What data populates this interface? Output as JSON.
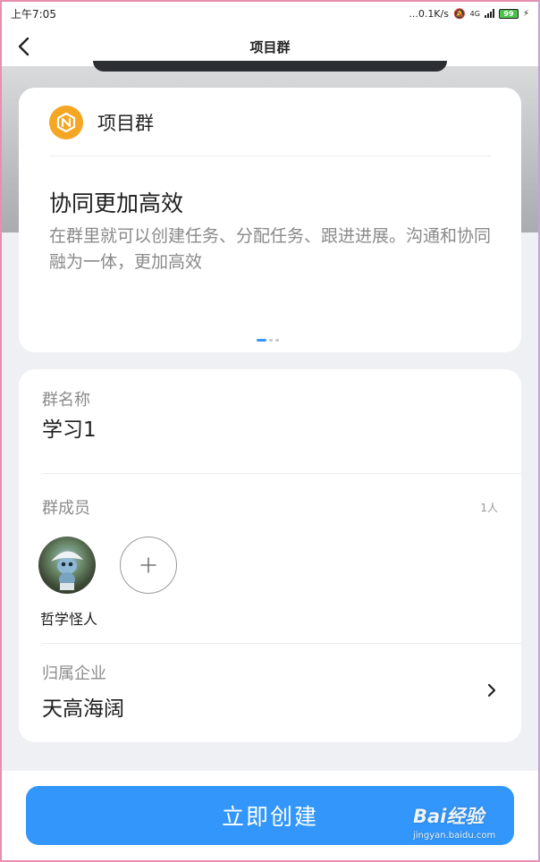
{
  "status_bar": {
    "time": "上午7:05",
    "network_speed": "...0.1K/s",
    "network_type": "4G",
    "battery": "99",
    "icons": [
      "bell-off-icon",
      "signal-icon",
      "battery-icon",
      "charging-icon"
    ]
  },
  "nav": {
    "title": "项目群",
    "back_icon": "chevron-left-icon"
  },
  "intro": {
    "brand_name": "项目群",
    "brand_icon": "project-group-logo-icon",
    "heading": "协同更加高效",
    "description": "在群里就可以创建任务、分配任务、跟进进展。沟通和协同融为一体，更加高效",
    "pager": {
      "pages": 3,
      "active": 1
    }
  },
  "form": {
    "group_name_label": "群名称",
    "group_name_value": "学习1",
    "members_label": "群成员",
    "members_count": "1人",
    "members": [
      {
        "name": "哲学怪人"
      }
    ],
    "add_member_icon": "plus-icon",
    "company_label": "归属企业",
    "company_value": "天高海阔",
    "company_icon": "chevron-right-icon"
  },
  "footer": {
    "create_label": "立即创建"
  },
  "watermark": {
    "logo": "Bai经验",
    "url": "jingyan.baidu.com"
  },
  "colors": {
    "accent": "#3296fa",
    "brand_orange": "#f5a623",
    "background": "#eef0f3"
  }
}
